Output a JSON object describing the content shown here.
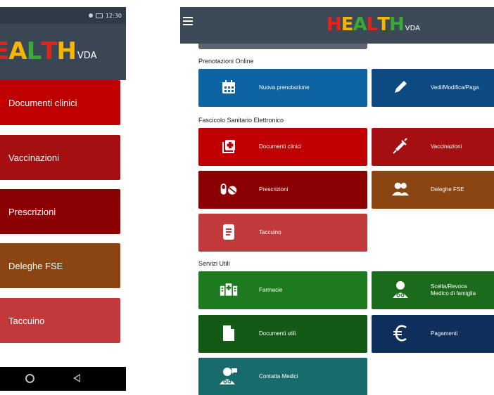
{
  "logo": {
    "word": "HEALTH",
    "suffix": "VDA",
    "colors": [
      "#e2231a",
      "#f5b500",
      "#3aa935",
      "#e2231a",
      "#f5b500",
      "#3aa935"
    ]
  },
  "phone": {
    "status_time": "12:30",
    "menu": [
      {
        "label": "Documenti clinici",
        "color": "#c00000"
      },
      {
        "label": "Vaccinazioni",
        "color": "#a50f12"
      },
      {
        "label": "Prescrizioni",
        "color": "#8b0000"
      },
      {
        "label": "Deleghe FSE",
        "color": "#8b4513"
      },
      {
        "label": "Taccuino",
        "color": "#c0393b"
      }
    ]
  },
  "tablet": {
    "sections": {
      "prenotazioni": "Prenotazioni Online",
      "fascicolo": "Fascicolo Sanitario Elettronico",
      "servizi": "Servizi Utili"
    },
    "tiles": {
      "nuova_prenotazione": {
        "label": "Nuova prenotazione",
        "icon": "calendar-icon",
        "color": "#0e63a3"
      },
      "vedi_modifica": {
        "label": "Vedi/Modifica/Paga",
        "icon": "pencil-icon",
        "color": "#0d4a82"
      },
      "documenti_clinici": {
        "label": "Documenti clinici",
        "icon": "medical-folder-icon",
        "color": "#c00000"
      },
      "vaccinazioni": {
        "label": "Vaccinazioni",
        "icon": "syringe-icon",
        "color": "#a50f12"
      },
      "prescrizioni": {
        "label": "Prescrizioni",
        "icon": "pills-icon",
        "color": "#8b0000"
      },
      "deleghe": {
        "label": "Deleghe FSE",
        "icon": "users-icon",
        "color": "#8b4513"
      },
      "taccuino": {
        "label": "Taccuino",
        "icon": "notebook-icon",
        "color": "#c0393b"
      },
      "farmacie": {
        "label": "Farmacie",
        "icon": "hospital-icon",
        "color": "#1e7a1e"
      },
      "scelta_revoca": {
        "line1": "Scelta/Revoca",
        "line2": "Medico di famiglia",
        "icon": "doctor-icon",
        "color": "#1c6b1c"
      },
      "documenti_utili": {
        "label": "Documenti utili",
        "icon": "document-icon",
        "color": "#145a14"
      },
      "pagamenti": {
        "label": "Pagamenti",
        "icon": "euro-icon",
        "color": "#0e2f5c"
      },
      "contatta_medici": {
        "label": "Contatta Medici",
        "icon": "doctor-chat-icon",
        "color": "#176b6b"
      }
    }
  }
}
